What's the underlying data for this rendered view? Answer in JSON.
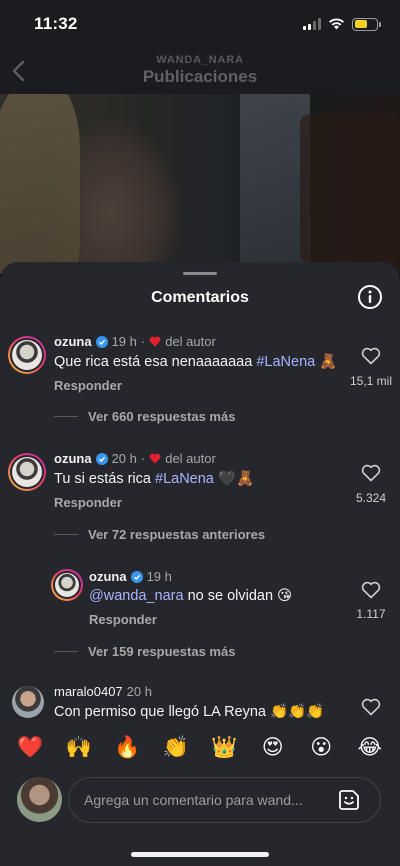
{
  "status_bar": {
    "time": "11:32",
    "battery_level": 0.6,
    "battery_color": "#f5d225"
  },
  "header": {
    "username": "WANDA_NARA",
    "title": "Publicaciones"
  },
  "sheet": {
    "title": "Comentarios"
  },
  "comments": [
    {
      "username": "ozuna",
      "verified": true,
      "time": "19 h",
      "separator": "·",
      "author_tag": "del autor",
      "text_plain": "Que rica está esa nenaaaaaaa ",
      "hashtag": "#LaNena",
      "text_suffix": " 🧸",
      "reply_label": "Responder",
      "like_count": "15,1 mil",
      "more_replies": "Ver 660 respuestas más"
    },
    {
      "username": "ozuna",
      "verified": true,
      "time": "20 h",
      "separator": "·",
      "author_tag": "del autor",
      "text_plain": "Tu si estás rica ",
      "hashtag": "#LaNena",
      "text_suffix": " 🖤🧸",
      "reply_label": "Responder",
      "like_count": "5.324",
      "previous_replies": "Ver 72 respuestas anteriores"
    },
    {
      "username": "ozuna",
      "verified": true,
      "time": "19 h",
      "mention": "@wanda_nara",
      "text_plain": " no se olvidan 😘",
      "reply_label": "Responder",
      "like_count": "1.117",
      "more_replies": "Ver 159 respuestas más"
    },
    {
      "username": "maralo0407",
      "time": "20 h",
      "text_plain": "Con permiso que llegó LA Reyna 👏👏👏"
    }
  ],
  "emoji_bar": [
    "❤️",
    "🙌",
    "🔥",
    "👏",
    "👑",
    "😍",
    "😮",
    "😂"
  ],
  "composer": {
    "placeholder": "Agrega un comentario para wand..."
  },
  "colors": {
    "sheet_bg": "#26272c",
    "hashtag": "#a9b4ff",
    "verified": "#3897f0",
    "heart": "#e0202e"
  }
}
